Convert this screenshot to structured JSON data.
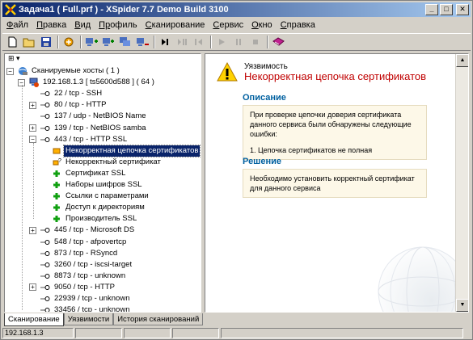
{
  "window": {
    "title": "Задача1 ( Full.prf ) - XSpider 7.7 Demo Build 3100",
    "min_label": "_",
    "max_label": "□",
    "close_label": "✕"
  },
  "menu": [
    {
      "label": "Файл",
      "ul": "Ф",
      "rest": "айл"
    },
    {
      "label": "Правка",
      "ul": "П",
      "rest": "равка"
    },
    {
      "label": "Вид",
      "ul": "В",
      "rest": "ид"
    },
    {
      "label": "Профиль",
      "ul": "Пр",
      "rest": "офиль"
    },
    {
      "label": "Сканирование",
      "ul": "С",
      "rest": "канирование"
    },
    {
      "label": "Сервис",
      "ul": "С",
      "rest": "ервис"
    },
    {
      "label": "Окно",
      "ul": "О",
      "rest": "кно"
    },
    {
      "label": "Справка",
      "ul": "С",
      "rest": "правка"
    }
  ],
  "toolbar": [
    {
      "icon": "new-document-icon",
      "enabled": true
    },
    {
      "icon": "open-folder-icon",
      "enabled": true
    },
    {
      "icon": "save-icon",
      "enabled": true
    },
    {
      "sep": true
    },
    {
      "icon": "profile-icon",
      "enabled": true
    },
    {
      "sep": true
    },
    {
      "icon": "add-host-icon",
      "enabled": true
    },
    {
      "icon": "add-hosts-icon",
      "enabled": true
    },
    {
      "icon": "hosts-icon",
      "enabled": true
    },
    {
      "icon": "remove-host-icon",
      "enabled": true
    },
    {
      "sep": true
    },
    {
      "icon": "step-forward-icon",
      "enabled": true
    },
    {
      "icon": "step-into-icon",
      "enabled": false
    },
    {
      "icon": "step-out-icon",
      "enabled": false
    },
    {
      "sep": true
    },
    {
      "icon": "play-icon",
      "enabled": false
    },
    {
      "icon": "pause-icon",
      "enabled": false
    },
    {
      "icon": "stop-icon",
      "enabled": false
    },
    {
      "sep": true
    },
    {
      "icon": "report-icon",
      "enabled": true
    }
  ],
  "left_header": "⊞ ▾",
  "tree": [
    {
      "label": "Сканируемые хосты ( 1 )",
      "level": 0,
      "icon": "globe-hosts-icon",
      "expander": "−"
    },
    {
      "label": "192.168.1.3 [ ts5600d588 ] ( 64 )",
      "level": 1,
      "icon": "host-computer-icon",
      "expander": "−"
    },
    {
      "label": "22 / tcp - SSH",
      "level": 2,
      "icon": "port-icon"
    },
    {
      "label": "80 / tcp - HTTP",
      "level": 2,
      "icon": "port-icon",
      "expander": "+"
    },
    {
      "label": "137 / udp - NetBIOS Name",
      "level": 2,
      "icon": "port-icon"
    },
    {
      "label": "139 / tcp - NetBIOS samba",
      "level": 2,
      "icon": "port-icon",
      "expander": "+"
    },
    {
      "label": "443 / tcp - HTTP SSL",
      "level": 2,
      "icon": "port-icon",
      "expander": "−"
    },
    {
      "label": "Некорректная цепочка сертификатов",
      "level": 3,
      "icon": "vulnerability-icon",
      "selected": true
    },
    {
      "label": "Некорректный сертификат",
      "level": 3,
      "icon": "warning-question-icon"
    },
    {
      "label": "Сертификат SSL",
      "level": 3,
      "icon": "info-plus-icon"
    },
    {
      "label": "Наборы шифров SSL",
      "level": 3,
      "icon": "info-plus-icon"
    },
    {
      "label": "Ссылки с параметрами",
      "level": 3,
      "icon": "info-plus-icon"
    },
    {
      "label": "Доступ к директориям",
      "level": 3,
      "icon": "info-plus-icon"
    },
    {
      "label": "Производитель SSL",
      "level": 3,
      "icon": "info-plus-icon"
    },
    {
      "label": "445 / tcp - Microsoft DS",
      "level": 2,
      "icon": "port-icon",
      "expander": "+"
    },
    {
      "label": "548 / tcp - afpovertcp",
      "level": 2,
      "icon": "port-icon"
    },
    {
      "label": "873 / tcp - RSyncd",
      "level": 2,
      "icon": "port-icon"
    },
    {
      "label": "3260 / tcp - iscsi-target",
      "level": 2,
      "icon": "port-icon"
    },
    {
      "label": "8873 / tcp - unknown",
      "level": 2,
      "icon": "port-icon"
    },
    {
      "label": "9050 / tcp - HTTP",
      "level": 2,
      "icon": "port-icon",
      "expander": "+"
    },
    {
      "label": "22939 / tcp - unknown",
      "level": 2,
      "icon": "port-icon"
    },
    {
      "label": "33456 / tcp - unknown",
      "level": 2,
      "icon": "port-icon"
    }
  ],
  "detail": {
    "category": "Уязвимость",
    "title": "Некорректная цепочка сертификатов",
    "description_heading": "Описание",
    "description_text": "При проверке цепочки доверия сертификата данного сервиса были обнаружены следующие ошибки:",
    "description_item": "1. Цепочка сертификатов не полная",
    "solution_heading": "Решение",
    "solution_text": "Необходимо установить корректный сертификат для данного сервиса"
  },
  "tabs": [
    {
      "label": "Сканирование",
      "active": true
    },
    {
      "label": "Уязвимости",
      "active": false
    },
    {
      "label": "История сканирований",
      "active": false
    }
  ],
  "status": {
    "host": "192.168.1.3"
  },
  "colors": {
    "accent": "#0a246a",
    "title_red": "#c00000",
    "heading_blue": "#0060a0",
    "box_bg": "#fdf8e8"
  }
}
